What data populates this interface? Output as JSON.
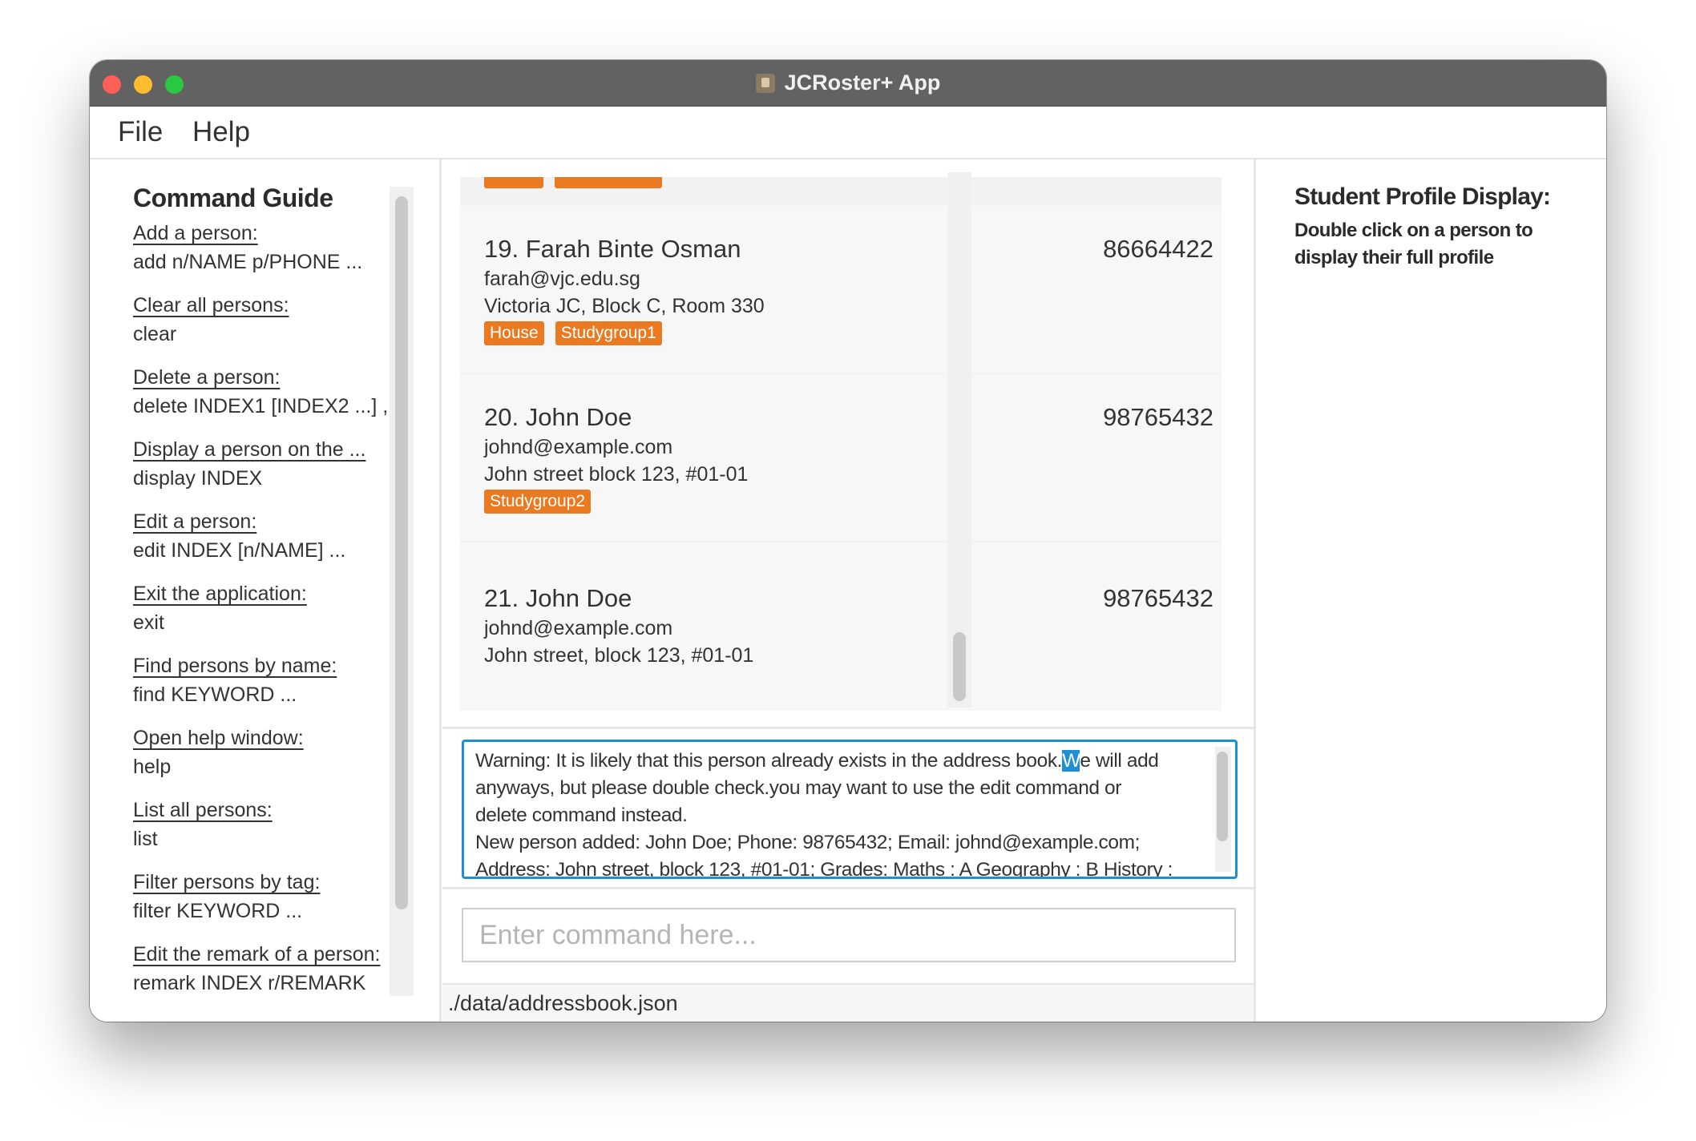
{
  "window": {
    "title": "JCRoster+ App"
  },
  "menu": {
    "file": "File",
    "help": "Help"
  },
  "guide": {
    "title": "Command Guide",
    "entries": [
      {
        "label": "Add a person:",
        "command": "add n/NAME p/PHONE ..."
      },
      {
        "label": "Clear all persons:",
        "command": "clear"
      },
      {
        "label": "Delete a person:",
        "command": "delete INDEX1 [INDEX2 ...] ,"
      },
      {
        "label": "Display a person on the ...",
        "command": "display INDEX"
      },
      {
        "label": "Edit a person:",
        "command": "edit INDEX [n/NAME] ..."
      },
      {
        "label": "Exit the application:",
        "command": "exit"
      },
      {
        "label": "Find persons by name:",
        "command": "find KEYWORD ..."
      },
      {
        "label": "Open help window:",
        "command": "help"
      },
      {
        "label": "List all persons:",
        "command": "list"
      },
      {
        "label": "Filter persons by tag:",
        "command": "filter KEYWORD ..."
      },
      {
        "label": "Edit the remark of a person:",
        "command": "remark INDEX r/REMARK"
      }
    ]
  },
  "persons": [
    {
      "name": "19. Farah Binte Osman",
      "phone": "86664422",
      "email": "farah@vjc.edu.sg",
      "address": "Victoria JC, Block C, Room 330",
      "tags": [
        "House",
        "Studygroup1"
      ]
    },
    {
      "name": "20. John Doe",
      "phone": "98765432",
      "email": "johnd@example.com",
      "address": "John street block 123, #01-01",
      "tags": [
        "Studygroup2"
      ]
    },
    {
      "name": "21. John Doe",
      "phone": "98765432",
      "email": "johnd@example.com",
      "address": "John street, block 123, #01-01",
      "tags": []
    }
  ],
  "result": {
    "line1_before": "Warning: It is likely that this person already exists in the address book.",
    "line1_selected": "W",
    "line1_after": "e will add",
    "line2": "anyways, but please double check.you may want to use the edit command or",
    "line3": "delete command instead.",
    "line4": "New person added: John Doe; Phone: 98765432; Email: johnd@example.com;",
    "line5": "Address: John street, block 123, #01-01; Grades: Maths : A Geography : B History :"
  },
  "command": {
    "placeholder": "Enter command here..."
  },
  "status": {
    "path": "./data/addressbook.json"
  },
  "profile": {
    "title": "Student Profile Display:",
    "subtitle": "Double click on a person to display their full profile"
  },
  "colors": {
    "accent": "#1d8fd4",
    "tag": "#ea7a22",
    "titlebar": "#626262"
  }
}
